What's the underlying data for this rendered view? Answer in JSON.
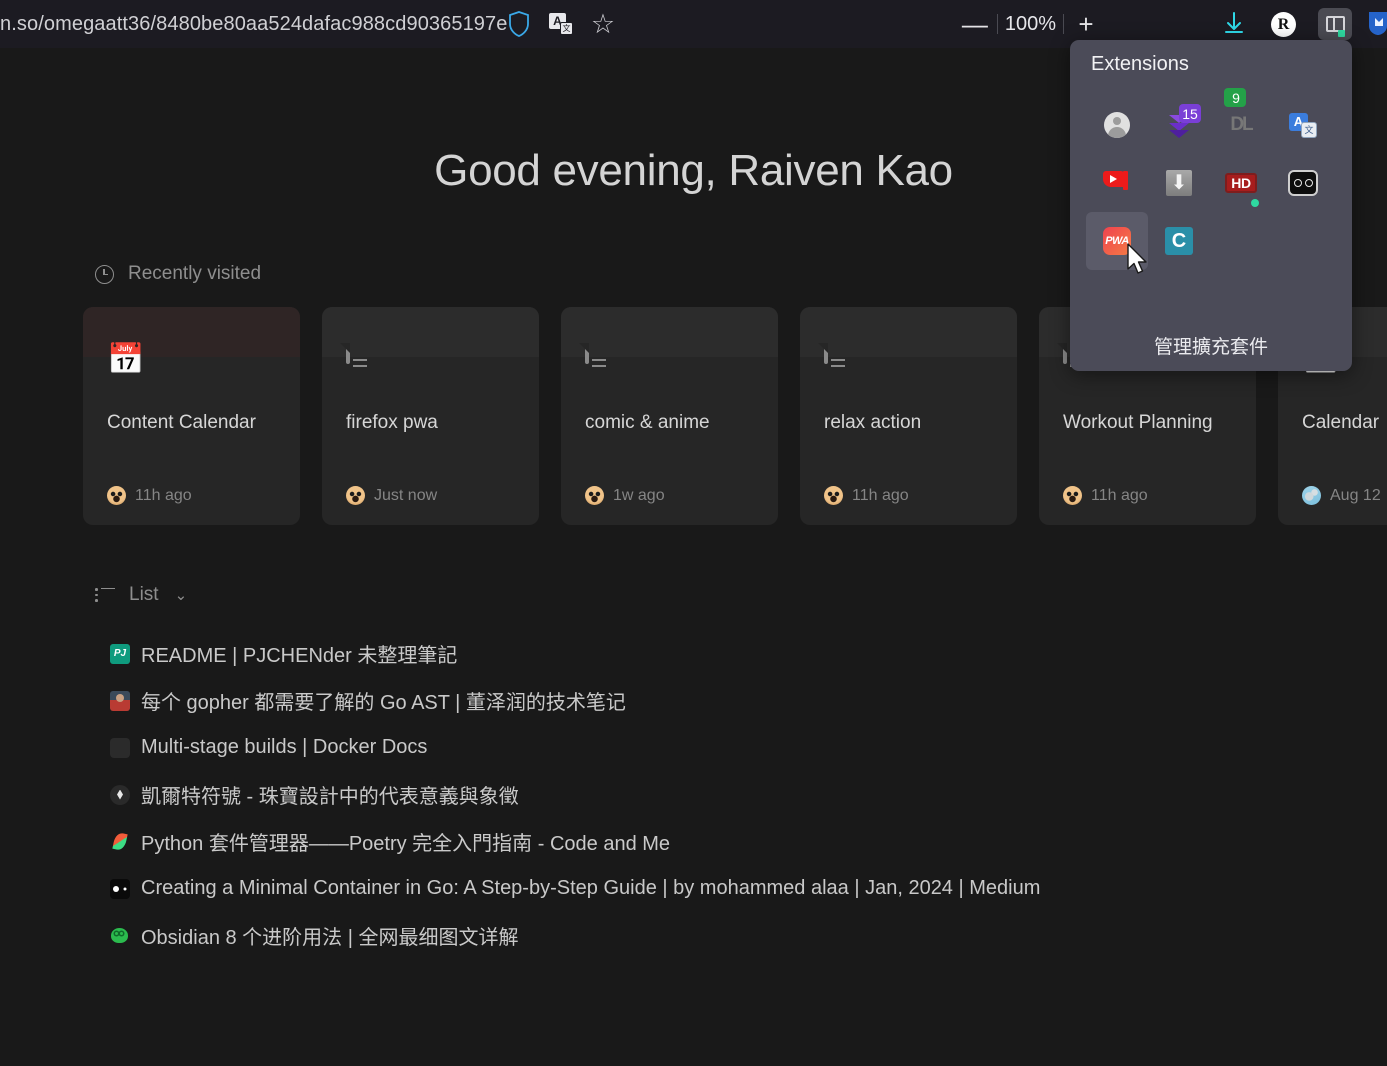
{
  "browser": {
    "url_visible": "n.so/omegaatt36/8480be80aa524dafac988cd90365197e",
    "url_host_fragment": "n.so",
    "url_path": "/omegaatt36/8480be80aa524dafac988cd90365197e",
    "zoom_level": "100%",
    "zoom_out_label": "—",
    "zoom_in_label": "+",
    "account_initial": "R",
    "icons": {
      "shield": "shield-icon",
      "translate": "translate-icon",
      "bookmark_star": "☆",
      "downloads": "download-icon",
      "sidebar_toggle": "sidebar-toggle-icon",
      "edge_pocket": "pocket-icon"
    }
  },
  "page": {
    "greeting": "Good evening, Raiven Kao",
    "recent": {
      "section_label": "Recently visited",
      "cards": [
        {
          "title": "Content Calendar",
          "time": "11h ago",
          "icon": "calendar-emoji",
          "emoji": "📅",
          "avatar": "dog",
          "tinted": true
        },
        {
          "title": "firefox pwa",
          "time": "Just now",
          "icon": "document-icon",
          "avatar": "dog",
          "tinted": false
        },
        {
          "title": "comic & anime",
          "time": "1w ago",
          "icon": "document-icon",
          "avatar": "dog",
          "tinted": false
        },
        {
          "title": "relax action",
          "time": "11h ago",
          "icon": "document-icon",
          "avatar": "dog",
          "tinted": false
        },
        {
          "title": "Workout Planning",
          "time": "11h ago",
          "icon": "document-wide-icon",
          "avatar": "dog",
          "tinted": false
        },
        {
          "title": "Calendar",
          "time": "Aug 12",
          "icon": "calendar-emoji",
          "emoji": "📅",
          "avatar": "globe",
          "tinted": false
        }
      ]
    },
    "list": {
      "section_label": "List",
      "chevron": "⌄",
      "items": [
        {
          "title": "README | PJCHENder 未整理筆記",
          "favicon": "pj"
        },
        {
          "title": "每个 gopher 都需要了解的 Go AST | 董泽润的技术笔记",
          "favicon": "person"
        },
        {
          "title": "Multi-stage builds | Docker Docs",
          "favicon": "docker"
        },
        {
          "title": "凱爾特符號 - 珠寶設計中的代表意義與象徵",
          "favicon": "celtic"
        },
        {
          "title": "Python 套件管理器——Poetry 完全入門指南 - Code and Me",
          "favicon": "leaf"
        },
        {
          "title": "Creating a Minimal Container in Go: A Step-by-Step Guide | by mohammed alaa | Jan, 2024 | Medium",
          "favicon": "medium"
        },
        {
          "title": "Obsidian 8 个进阶用法 | 全网最细图文详解",
          "favicon": "wechat"
        }
      ]
    }
  },
  "extensions_panel": {
    "title": "Extensions",
    "manage_label": "管理擴充套件",
    "items": [
      {
        "name": "account-extension",
        "icon": "person-avatar-icon",
        "badge": null,
        "hover": false,
        "dot": false
      },
      {
        "name": "download-manager-extension",
        "icon": "purple-download-stack-icon",
        "badge": "15",
        "badge_color": "#7a3fd6",
        "hover": false,
        "dot": false
      },
      {
        "name": "downloader-extension",
        "icon": "dark-dl-icon",
        "badge": "9",
        "badge_color": "#24a148",
        "hover": false,
        "dot": false
      },
      {
        "name": "translate-extension",
        "icon": "translate-icon",
        "badge": null,
        "hover": false,
        "dot": false
      },
      {
        "name": "youtube-extension",
        "icon": "youtube-icon",
        "badge": null,
        "hover": false,
        "dot": false
      },
      {
        "name": "video-download-extension",
        "icon": "gray-download-icon",
        "badge": null,
        "hover": false,
        "dot": false
      },
      {
        "name": "hd-video-extension",
        "icon": "hd-badge-icon",
        "badge": null,
        "hover": false,
        "dot": true
      },
      {
        "name": "privacy-badger-extension",
        "icon": "two-circles-icon",
        "badge": null,
        "hover": false,
        "dot": false
      },
      {
        "name": "pwa-extension",
        "icon": "pwa-icon",
        "label": "PWA",
        "badge": null,
        "hover": true,
        "dot": false
      },
      {
        "name": "c-extension",
        "icon": "letter-c-icon",
        "label": "C",
        "badge": null,
        "hover": false,
        "dot": false
      }
    ]
  },
  "colors": {
    "page_bg": "#191919",
    "chrome_bg": "#1c1b22",
    "card_bg": "#262626",
    "panel_bg": "#4b4b58",
    "accent_cyan": "#2fd9e8",
    "accent_green": "#2fd9a0"
  }
}
